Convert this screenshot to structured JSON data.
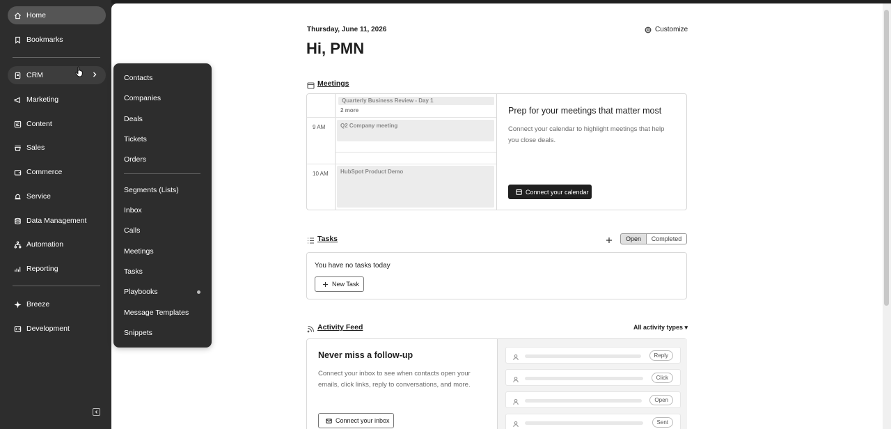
{
  "sidebar": {
    "items": [
      {
        "label": "Home",
        "icon": "home-icon"
      },
      {
        "label": "Bookmarks",
        "icon": "bookmark-icon"
      },
      {
        "label": "CRM",
        "icon": "crm-icon"
      },
      {
        "label": "Marketing",
        "icon": "megaphone-icon"
      },
      {
        "label": "Content",
        "icon": "content-icon"
      },
      {
        "label": "Sales",
        "icon": "sales-icon"
      },
      {
        "label": "Commerce",
        "icon": "wallet-icon"
      },
      {
        "label": "Service",
        "icon": "bell-icon"
      },
      {
        "label": "Data Management",
        "icon": "database-icon"
      },
      {
        "label": "Automation",
        "icon": "workflow-icon"
      },
      {
        "label": "Reporting",
        "icon": "chart-icon"
      },
      {
        "label": "Breeze",
        "icon": "sparkle-icon"
      },
      {
        "label": "Development",
        "icon": "code-icon"
      }
    ]
  },
  "crm_menu": {
    "items": [
      "Contacts",
      "Companies",
      "Deals",
      "Tickets",
      "Orders",
      "Segments (Lists)",
      "Inbox",
      "Calls",
      "Meetings",
      "Tasks",
      "Playbooks",
      "Message Templates",
      "Snippets"
    ]
  },
  "header": {
    "date": "Thursday, June 11, 2026",
    "greeting": "Hi, PMN",
    "customize": "Customize"
  },
  "meetings": {
    "title": "Meetings",
    "allday_event": "Quarterly Business Review - Day 1",
    "more": "2 more",
    "times": [
      "9 AM",
      "10 AM"
    ],
    "events": [
      "Q2 Company meeting",
      "HubSpot Product Demo"
    ],
    "prep_title": "Prep for your meetings that matter most",
    "prep_text": "Connect your calendar to highlight meetings that help you close deals.",
    "connect_button": "Connect your calendar"
  },
  "tasks": {
    "title": "Tasks",
    "tab_open": "Open",
    "tab_completed": "Completed",
    "empty": "You have no tasks today",
    "new_task": "New Task"
  },
  "activity": {
    "title": "Activity Feed",
    "filter": "All activity types",
    "heading": "Never miss a follow-up",
    "text": "Connect your inbox to see when contacts open your emails, click links, reply to conversations, and more.",
    "connect_button": "Connect your inbox",
    "rows": [
      "Reply",
      "Click",
      "Open",
      "Sent"
    ]
  }
}
